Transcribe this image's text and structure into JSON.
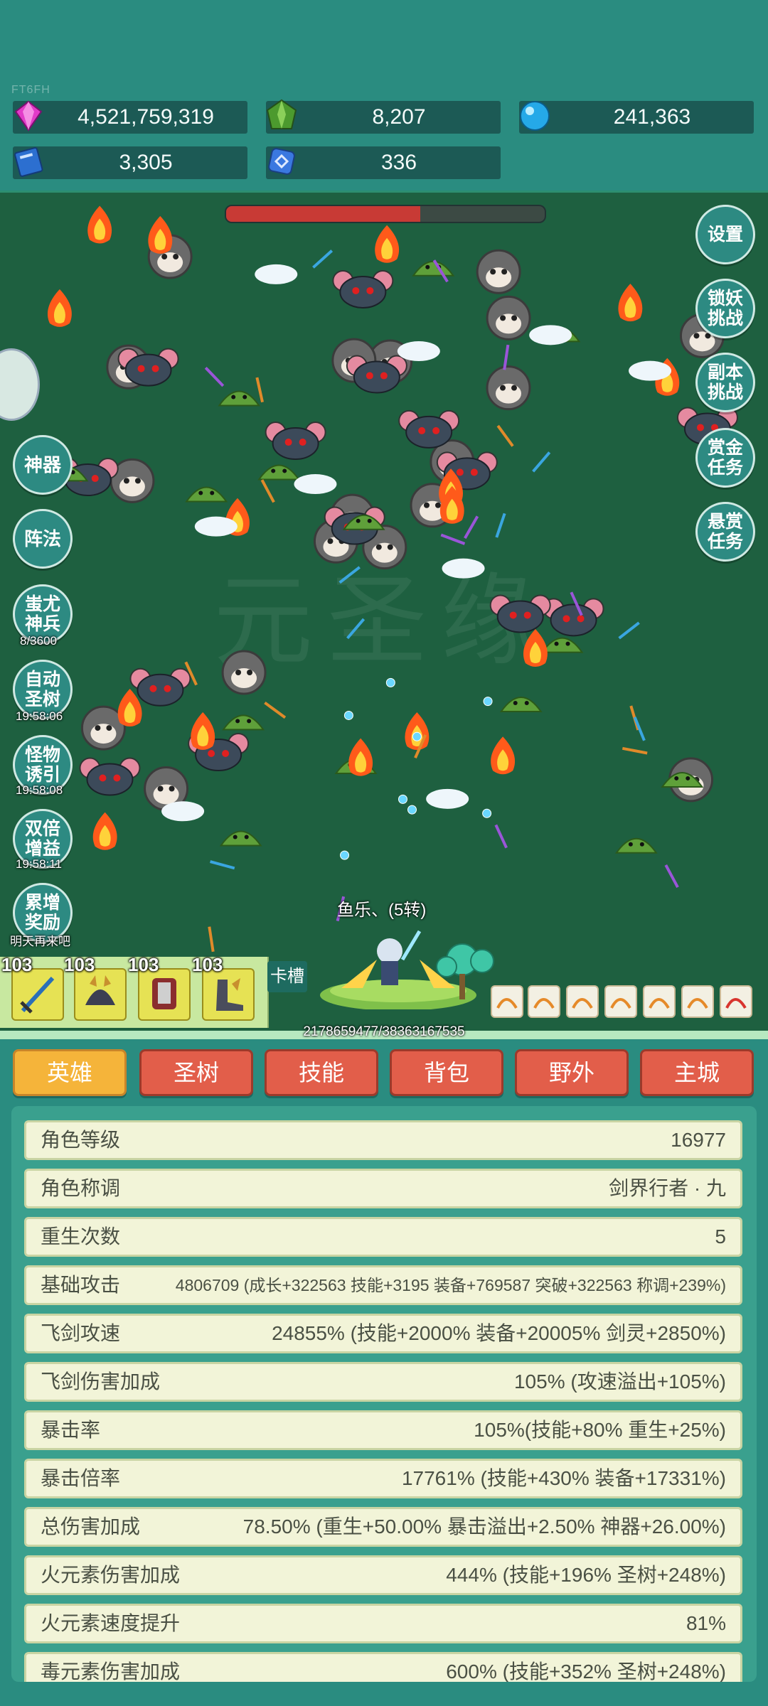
{
  "top": {
    "tiny_code": "FT6FH",
    "resources": [
      {
        "name": "gem",
        "value": "4,521,759,319",
        "icon": "pink-gem-icon",
        "color": "#e23bc8"
      },
      {
        "name": "green-crystal",
        "value": "8,207",
        "icon": "green-crystal-icon",
        "color": "#4c9a2e"
      },
      {
        "name": "blue-orb",
        "value": "241,363",
        "icon": "blue-orb-icon",
        "color": "#25a9e8"
      },
      {
        "name": "book",
        "value": "3,305",
        "icon": "blue-book-icon",
        "color": "#2c6fd0"
      },
      {
        "name": "rune",
        "value": "336",
        "icon": "blue-rune-icon",
        "color": "#3a78e0"
      }
    ]
  },
  "battle": {
    "boss_hp_fraction": 0.61,
    "watermark": "元圣缘",
    "hero_name": "鱼乐、(5转)",
    "exp_text": "2178659477/38363167535",
    "right_buttons": [
      {
        "name": "settings-button",
        "label": "设置"
      },
      {
        "name": "lock-demon-challenge-button",
        "label": "锁妖挑战"
      },
      {
        "name": "dungeon-challenge-button",
        "label": "副本挑战"
      },
      {
        "name": "bounty-mission-button",
        "label": "赏金任务"
      },
      {
        "name": "reward-mission-button",
        "label": "悬赏任务"
      }
    ],
    "left_buttons": [
      {
        "name": "artifact-button",
        "label": "神器",
        "sub": ""
      },
      {
        "name": "formation-button",
        "label": "阵法",
        "sub": ""
      },
      {
        "name": "chiyou-weapon-button",
        "label": "蚩尤神兵",
        "sub": "8/3600"
      },
      {
        "name": "auto-tree-button",
        "label": "自动圣树",
        "sub": "19:58:06"
      },
      {
        "name": "monster-lure-button",
        "label": "怪物诱引",
        "sub": "19:58:08"
      },
      {
        "name": "double-gain-button",
        "label": "双倍增益",
        "sub": "19:58:11"
      },
      {
        "name": "cumulative-reward-button",
        "label": "累增奖励",
        "sub": "明天再来吧"
      }
    ],
    "equip_slots": [
      {
        "level": "103",
        "icon": "sword-icon"
      },
      {
        "level": "103",
        "icon": "helmet-icon"
      },
      {
        "level": "103",
        "icon": "armor-icon"
      },
      {
        "level": "103",
        "icon": "boots-icon"
      }
    ],
    "card_slot_label": "卡槽"
  },
  "tabs": [
    {
      "label": "英雄",
      "active": true
    },
    {
      "label": "圣树",
      "active": false
    },
    {
      "label": "技能",
      "active": false
    },
    {
      "label": "背包",
      "active": false
    },
    {
      "label": "野外",
      "active": false
    },
    {
      "label": "主城",
      "active": false
    }
  ],
  "stats": [
    {
      "label": "角色等级",
      "value": "16977"
    },
    {
      "label": "角色称调",
      "value": "剑界行者 · 九"
    },
    {
      "label": "重生次数",
      "value": "5"
    },
    {
      "label": "基础攻击",
      "value": "4806709 (成长+322563 技能+3195 装备+769587 突破+322563 称调+239%)"
    },
    {
      "label": "飞剑攻速",
      "value": "24855% (技能+2000% 装备+20005% 剑灵+2850%)"
    },
    {
      "label": "飞剑伤害加成",
      "value": "105% (攻速溢出+105%)"
    },
    {
      "label": "暴击率",
      "value": "105%(技能+80% 重生+25%)"
    },
    {
      "label": "暴击倍率",
      "value": "17761% (技能+430% 装备+17331%)"
    },
    {
      "label": "总伤害加成",
      "value": "78.50% (重生+50.00% 暴击溢出+2.50% 神器+26.00%)"
    },
    {
      "label": "火元素伤害加成",
      "value": "444% (技能+196% 圣树+248%)"
    },
    {
      "label": "火元素速度提升",
      "value": "81%"
    },
    {
      "label": "毒元素伤害加成",
      "value": "600% (技能+352% 圣树+248%)"
    }
  ]
}
